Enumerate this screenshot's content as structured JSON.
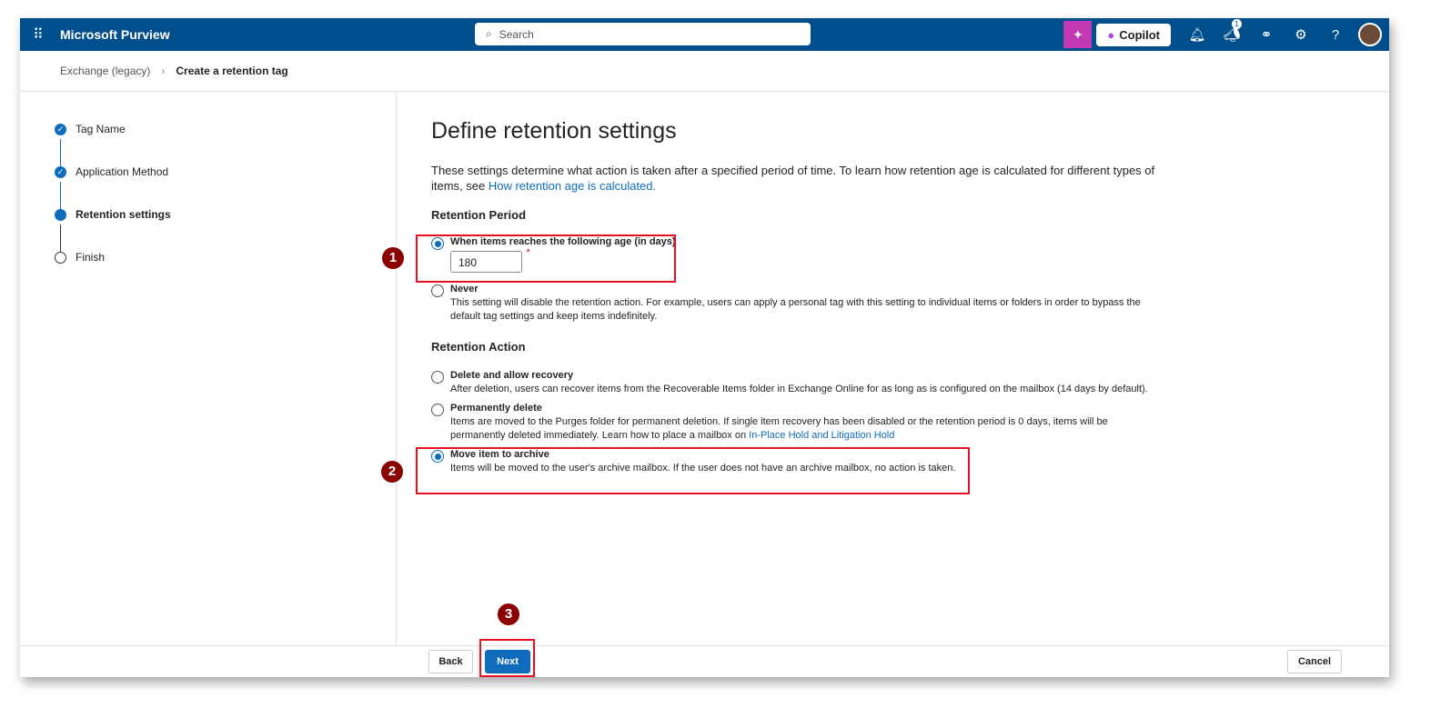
{
  "header": {
    "app_title": "Microsoft Purview",
    "search_placeholder": "Search",
    "copilot_label": "Copilot",
    "notification_badge": "1"
  },
  "breadcrumb": {
    "parent": "Exchange (legacy)",
    "current": "Create a retention tag"
  },
  "steps": [
    {
      "label": "Tag Name",
      "state": "complete"
    },
    {
      "label": "Application Method",
      "state": "complete"
    },
    {
      "label": "Retention settings",
      "state": "current"
    },
    {
      "label": "Finish",
      "state": "pending"
    }
  ],
  "main": {
    "title": "Define retention settings",
    "intro": "These settings determine what action is taken after a specified period of time. To learn how retention age is calculated for different types of items, see ",
    "intro_link": "How retention age is calculated.",
    "period_heading": "Retention Period",
    "period_age_label": "When items reaches the following age (in days)",
    "period_age_value": "180",
    "required_mark": "*",
    "never_label": "Never",
    "never_desc": "This setting will disable the retention action. For example, users can apply a personal tag with this setting to individual items or folders in order to bypass the default tag settings and keep items indefinitely.",
    "action_heading": "Retention Action",
    "delete_label": "Delete and allow recovery",
    "delete_desc": "After deletion, users can recover items from the Recoverable Items folder in Exchange Online for as long as is configured on the mailbox (14 days by default).",
    "perm_label": "Permanently delete",
    "perm_desc": "Items are moved to the Purges folder for permanent deletion. If single item recovery has been disabled or the retention period is 0 days, items will be permanently deleted immediately. Learn how to place a mailbox on ",
    "perm_link": "In-Place Hold and Litigation Hold",
    "archive_label": "Move item to archive",
    "archive_desc": "Items will be moved to the user's archive mailbox. If the user does not have an archive mailbox, no action is taken."
  },
  "annotations": [
    "1",
    "2",
    "3"
  ],
  "footer": {
    "back": "Back",
    "next": "Next",
    "cancel": "Cancel"
  }
}
